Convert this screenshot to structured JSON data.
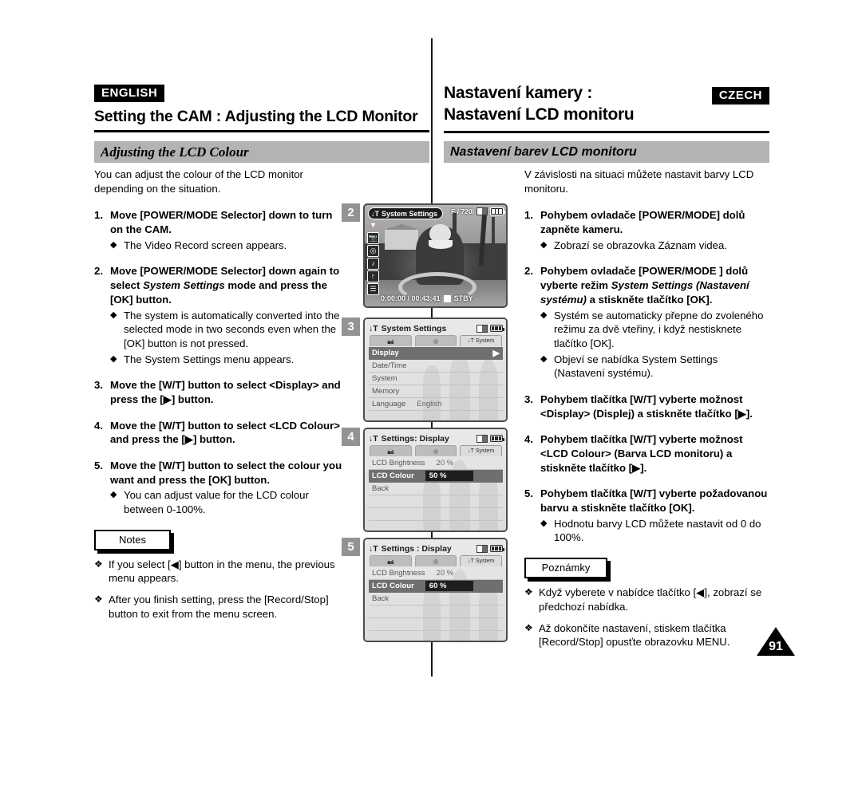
{
  "header": {
    "left_lang": "ENGLISH",
    "left_title": "Setting the CAM : Adjusting the LCD Monitor",
    "right_title_line1": "Nastavení kamery :",
    "right_title_line2": "Nastavení LCD monitoru",
    "right_lang": "CZECH"
  },
  "section": {
    "left": "Adjusting the LCD Colour",
    "right": "Nastavení barev LCD monitoru"
  },
  "left_column": {
    "intro": "You can adjust the colour of the LCD monitor depending on the situation.",
    "steps": [
      {
        "num": "1.",
        "text": "Move [POWER/MODE Selector] down to turn on the CAM.",
        "bullets": [
          "The Video Record screen appears."
        ]
      },
      {
        "num": "2.",
        "text_a": "Move [POWER/MODE Selector] down again to select ",
        "text_italic": "System Settings",
        "text_b": " mode and press the [OK] button.",
        "bullets": [
          "The system is automatically converted into the selected mode in two seconds even when the [OK] button is not pressed.",
          "The System Settings menu appears."
        ]
      },
      {
        "num": "3.",
        "text": "Move the [W/T] button to select <Display> and press the [▶] button.",
        "bullets": []
      },
      {
        "num": "4.",
        "text": "Move the [W/T] button to select <LCD Colour> and press the [▶] button.",
        "bullets": []
      },
      {
        "num": "5.",
        "text": "Move the [W/T] button to select the colour you want and press the [OK] button.",
        "bullets": [
          "You can adjust value for the LCD colour between 0-100%."
        ]
      }
    ],
    "notes_label": "Notes",
    "notes": [
      "If you select [◀] button in the menu, the previous menu appears.",
      "After you finish setting, press the [Record/Stop] button to exit from the menu screen."
    ]
  },
  "right_column": {
    "intro": "V závislosti na situaci můžete nastavit barvy LCD monitoru.",
    "steps": [
      {
        "num": "1.",
        "text": "Pohybem ovladače [POWER/MODE] dolů zapněte kameru.",
        "bullets": [
          "Zobrazí se obrazovka Záznam videa."
        ]
      },
      {
        "num": "2.",
        "text_a": "Pohybem ovladače [POWER/MODE ] dolů vyberte režim ",
        "text_italic": "System Settings (Nastavení systému)",
        "text_b": " a stiskněte tlačítko [OK].",
        "bullets": [
          "Systém se automaticky přepne do zvoleného režimu za dvě vteřiny, i když nestisknete tlačítko [OK].",
          "Objeví se nabídka System Settings (Nastavení systému)."
        ]
      },
      {
        "num": "3.",
        "text": "Pohybem tlačítka [W/T] vyberte možnost <Display> (Displej) a stiskněte tlačítko [▶].",
        "bullets": []
      },
      {
        "num": "4.",
        "text": "Pohybem tlačítka [W/T] vyberte možnost <LCD Colour> (Barva LCD monitoru) a stiskněte tlačítko [▶].",
        "bullets": []
      },
      {
        "num": "5.",
        "text": "Pohybem tlačítka [W/T] vyberte požadovanou barvu a stiskněte tlačítko [OK].",
        "bullets": [
          "Hodnotu barvy LCD můžete nastavit od 0 do 100%."
        ]
      }
    ],
    "notes_label": "Poznámky",
    "notes": [
      "Když vyberete v nabídce tlačítko [◀], zobrazí se předchozí nabídka.",
      "Až dokončíte nastavení, stiskem tlačítka [Record/Stop] opusťte obrazovku MENU."
    ]
  },
  "lcd_panels": [
    {
      "badge": "2",
      "type": "video-record",
      "mode_tag": "System Settings",
      "mode_icons": [
        "system-settings-icon",
        "chevron-down-icon",
        "camcorder-icon",
        "camera-icon",
        "music-note-icon",
        "microphone-icon",
        "file-list-icon"
      ],
      "top_right_text": "F / 720i",
      "counter": "0:00:00 / 00:43:41",
      "status": "STBY"
    },
    {
      "badge": "3",
      "type": "menu",
      "title": "System Settings",
      "tabs": [
        "camcorder-tab",
        "camera-tab",
        "System"
      ],
      "active_tab_index": 2,
      "rows": [
        {
          "label": "Display",
          "value": "",
          "selected": true,
          "arrow": "▶"
        },
        {
          "label": "Date/Time",
          "value": "",
          "selected": false
        },
        {
          "label": "System",
          "value": "",
          "selected": false
        },
        {
          "label": "Memory",
          "value": "",
          "selected": false
        },
        {
          "label": "Language",
          "value": "English",
          "selected": false
        }
      ]
    },
    {
      "badge": "4",
      "type": "menu",
      "title": "Settings: Display",
      "tabs": [
        "camcorder-tab",
        "camera-tab",
        "System"
      ],
      "active_tab_index": 2,
      "rows": [
        {
          "label": "LCD Brightness",
          "value": "20 %",
          "selected": false
        },
        {
          "label": "LCD Colour",
          "value": "50 %",
          "selected": true
        },
        {
          "label": "Back",
          "value": "",
          "selected": false
        }
      ]
    },
    {
      "badge": "5",
      "type": "menu",
      "title": "Settings : Display",
      "tabs": [
        "camcorder-tab",
        "camera-tab",
        "System"
      ],
      "active_tab_index": 2,
      "rows": [
        {
          "label": "LCD Brightness",
          "value": "20 %",
          "selected": false
        },
        {
          "label": "LCD Colour",
          "value": "60 %",
          "selected": true
        },
        {
          "label": "Back",
          "value": "",
          "selected": false
        }
      ]
    }
  ],
  "page_number": "91",
  "colors": {
    "section_bar": "#b3b3b3",
    "badge_gray": "#939393",
    "menu_selected": "#6f6f6f"
  }
}
